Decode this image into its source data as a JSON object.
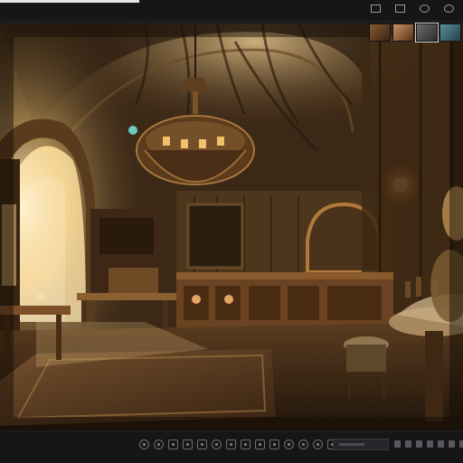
{
  "topbar": {
    "progress_fraction": 0.3,
    "icons": [
      "menu-icon",
      "mail-icon",
      "search-icon",
      "account-icon"
    ]
  },
  "viewer": {
    "image_subject": "fantasy-tavern-interior"
  },
  "thumbnails": {
    "count": 4,
    "active_index": 2
  },
  "toolbar": {
    "icons": [
      "rotate-left-icon",
      "rotate-right-icon",
      "flip-icon",
      "crop-icon",
      "adjust-icon",
      "filter-icon",
      "brush-icon",
      "text-icon",
      "shape-icon",
      "layers-icon",
      "undo-icon",
      "redo-icon",
      "info-icon",
      "delete-icon",
      "share-icon",
      "fit-icon"
    ],
    "zoom_icons": [
      "zoom-out-icon",
      "zoom-in-icon",
      "fullscreen-icon",
      "grid-icon",
      "more-icon",
      "settings-icon",
      "close-icon"
    ]
  },
  "colors": {
    "background": "#1c1c1e",
    "bar": "#161618",
    "accent": "#e4e4e4",
    "warm_light": "#f3d59a"
  }
}
